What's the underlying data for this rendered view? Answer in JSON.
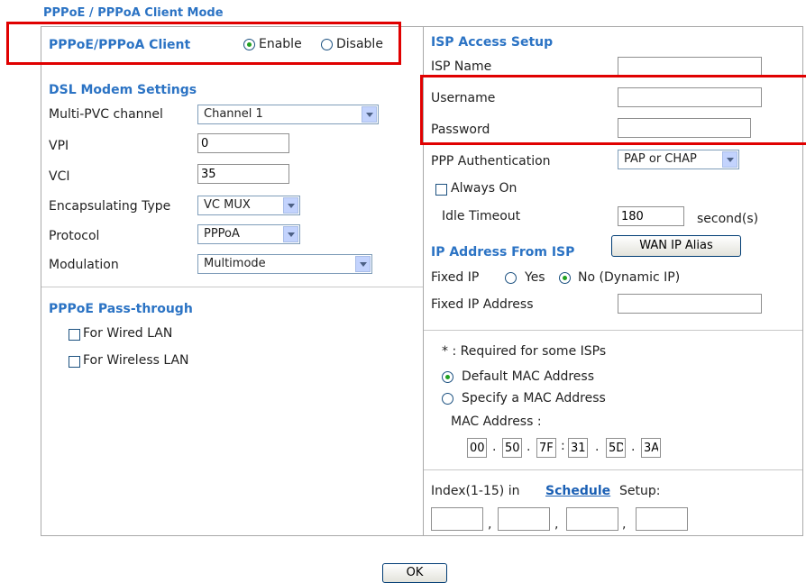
{
  "page_title": "PPPoE / PPPoA Client Mode",
  "client": {
    "label": "PPPoE/PPPoA Client",
    "enable_label": "Enable",
    "disable_label": "Disable",
    "selected": "Enable"
  },
  "dsl": {
    "heading": "DSL Modem Settings",
    "multi_pvc_label": "Multi-PVC channel",
    "multi_pvc_value": "Channel 1",
    "vpi_label": "VPI",
    "vpi_value": "0",
    "vci_label": "VCI",
    "vci_value": "35",
    "encap_label": "Encapsulating Type",
    "encap_value": "VC MUX",
    "protocol_label": "Protocol",
    "protocol_value": "PPPoA",
    "modulation_label": "Modulation",
    "modulation_value": "Multimode"
  },
  "passthrough": {
    "heading": "PPPoE Pass-through",
    "wired_label": "For Wired LAN",
    "wireless_label": "For Wireless LAN"
  },
  "isp": {
    "heading": "ISP Access Setup",
    "isp_name_label": "ISP Name",
    "username_label": "Username",
    "password_label": "Password",
    "ppp_auth_label": "PPP Authentication",
    "ppp_auth_value": "PAP or CHAP",
    "always_on_label": "Always On",
    "idle_timeout_label": "Idle Timeout",
    "idle_timeout_value": "180",
    "idle_timeout_unit": "second(s)"
  },
  "ip": {
    "heading": "IP Address From ISP",
    "wan_alias_button": "WAN IP Alias",
    "fixed_ip_label": "Fixed IP",
    "yes_label": "Yes",
    "no_label": "No (Dynamic IP)",
    "fixed_ip_address_label": "Fixed IP Address"
  },
  "mac": {
    "note": "* : Required for some ISPs",
    "default_label": "Default MAC Address",
    "specify_label": "Specify a MAC Address",
    "address_label": "MAC Address :",
    "octets": [
      "00",
      "50",
      "7F",
      "31",
      "5D",
      "3A"
    ],
    "separators": [
      ".",
      ".",
      ":",
      ".",
      "."
    ]
  },
  "schedule": {
    "prefix": "Index(1-15) in",
    "link": "Schedule",
    "suffix": "Setup:",
    "commas": [
      ",",
      ",",
      ","
    ]
  },
  "ok_button": "OK"
}
